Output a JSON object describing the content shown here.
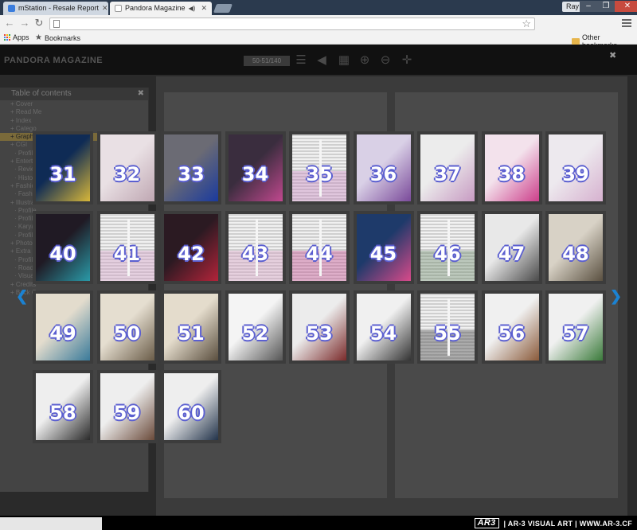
{
  "browser": {
    "tabs": [
      {
        "title": "mStation - Resale Report",
        "favicon_color": "#3b7ddd"
      },
      {
        "title": "Pandora Magazine",
        "favicon_color": "#ffffff"
      }
    ],
    "user": "Ray",
    "window_buttons": [
      "‒",
      "❐",
      "✕"
    ],
    "url": "",
    "bookmarks": {
      "apps": "Apps",
      "bookmarks": "Bookmarks",
      "other": "Other bookmarks"
    }
  },
  "magazine": {
    "title": "PANDORA MAGAZINE",
    "page_indicator": "50-51/140",
    "toc": {
      "heading": "Table of contents",
      "items": [
        {
          "label": "Cover",
          "sub": false
        },
        {
          "label": "Read Me",
          "sub": false
        },
        {
          "label": "Index",
          "sub": false
        },
        {
          "label": "Catego",
          "sub": false
        },
        {
          "label": "Graph",
          "sub": false,
          "highlight": true
        },
        {
          "label": "CGI",
          "sub": false
        },
        {
          "label": "Profile",
          "sub": true
        },
        {
          "label": "Entertai",
          "sub": false
        },
        {
          "label": "Review",
          "sub": true
        },
        {
          "label": "History",
          "sub": true
        },
        {
          "label": "Fashion",
          "sub": false
        },
        {
          "label": "Fashion",
          "sub": true
        },
        {
          "label": "Illustratio",
          "sub": false
        },
        {
          "label": "Profile",
          "sub": true
        },
        {
          "label": "Profile",
          "sub": true
        },
        {
          "label": "Karya C",
          "sub": true
        },
        {
          "label": "Profile",
          "sub": true
        },
        {
          "label": "Photography",
          "sub": false
        },
        {
          "label": "Extra",
          "sub": false
        },
        {
          "label": "Profile",
          "sub": true
        },
        {
          "label": "Road to",
          "sub": true
        },
        {
          "label": "Visual",
          "sub": true
        },
        {
          "label": "Credits",
          "sub": false
        },
        {
          "label": "Back C",
          "sub": false
        }
      ]
    },
    "thumbnails": [
      {
        "page": "31",
        "style": "art",
        "colors": [
          "#0f2b55",
          "#d7b73a"
        ]
      },
      {
        "page": "32",
        "style": "art",
        "colors": [
          "#e9e0e4",
          "#bfa7b2"
        ]
      },
      {
        "page": "33",
        "style": "art",
        "colors": [
          "#6b6b74",
          "#1a3a9e"
        ]
      },
      {
        "page": "34",
        "style": "art",
        "colors": [
          "#3a2d3e",
          "#c0488e"
        ]
      },
      {
        "page": "35",
        "style": "text",
        "colors": [
          "#f0f0f0",
          "#c886c0"
        ]
      },
      {
        "page": "36",
        "style": "art",
        "colors": [
          "#d9d0e6",
          "#7a4a9a"
        ]
      },
      {
        "page": "37",
        "style": "art",
        "colors": [
          "#ececec",
          "#c79ac2"
        ]
      },
      {
        "page": "38",
        "style": "art",
        "colors": [
          "#f3e2ec",
          "#cc3e8a"
        ]
      },
      {
        "page": "39",
        "style": "art",
        "colors": [
          "#ede9ee",
          "#d6b1cf"
        ]
      },
      {
        "page": "40",
        "style": "art",
        "colors": [
          "#201a24",
          "#2a9aa8"
        ]
      },
      {
        "page": "41",
        "style": "text",
        "colors": [
          "#f0f0f0",
          "#d4a0c8"
        ]
      },
      {
        "page": "42",
        "style": "art",
        "colors": [
          "#2b1a22",
          "#b3243a"
        ]
      },
      {
        "page": "43",
        "style": "text",
        "colors": [
          "#f0f0f0",
          "#d8a0c4"
        ]
      },
      {
        "page": "44",
        "style": "text",
        "colors": [
          "#f0f0f0",
          "#c44a8e"
        ]
      },
      {
        "page": "45",
        "style": "art",
        "colors": [
          "#1e3a6a",
          "#d84a8a"
        ]
      },
      {
        "page": "46",
        "style": "text",
        "colors": [
          "#f2f2f2",
          "#6c8a6a"
        ]
      },
      {
        "page": "47",
        "style": "art",
        "colors": [
          "#e8e8e8",
          "#4a4a4a"
        ]
      },
      {
        "page": "48",
        "style": "art",
        "colors": [
          "#d8d2c6",
          "#5a5040"
        ]
      },
      {
        "page": "49",
        "style": "art",
        "colors": [
          "#e3dccd",
          "#3a7a9a"
        ]
      },
      {
        "page": "50",
        "style": "art",
        "colors": [
          "#e5ded0",
          "#6a5c48"
        ]
      },
      {
        "page": "51",
        "style": "art",
        "colors": [
          "#e4dccc",
          "#5a4e3e"
        ]
      },
      {
        "page": "52",
        "style": "art",
        "colors": [
          "#f4f4f4",
          "#555555"
        ]
      },
      {
        "page": "53",
        "style": "art",
        "colors": [
          "#ececec",
          "#7a2a2a"
        ]
      },
      {
        "page": "54",
        "style": "art",
        "colors": [
          "#f0f0f0",
          "#333333"
        ]
      },
      {
        "page": "55",
        "style": "text",
        "colors": [
          "#f0f0f0",
          "#444444"
        ]
      },
      {
        "page": "56",
        "style": "art",
        "colors": [
          "#f0f0f0",
          "#8a5a3a"
        ]
      },
      {
        "page": "57",
        "style": "art",
        "colors": [
          "#f0f0f0",
          "#3a7a3a"
        ]
      },
      {
        "page": "58",
        "style": "art",
        "colors": [
          "#eeeeee",
          "#2a2a2a"
        ]
      },
      {
        "page": "59",
        "style": "art",
        "colors": [
          "#eeeeee",
          "#6a4a3a"
        ]
      },
      {
        "page": "60",
        "style": "art",
        "colors": [
          "#eeeeee",
          "#22334a"
        ]
      }
    ],
    "brand": {
      "logo": "AR3",
      "text": "| AR-3 VISUAL ART | WWW.AR-3.CF"
    }
  }
}
